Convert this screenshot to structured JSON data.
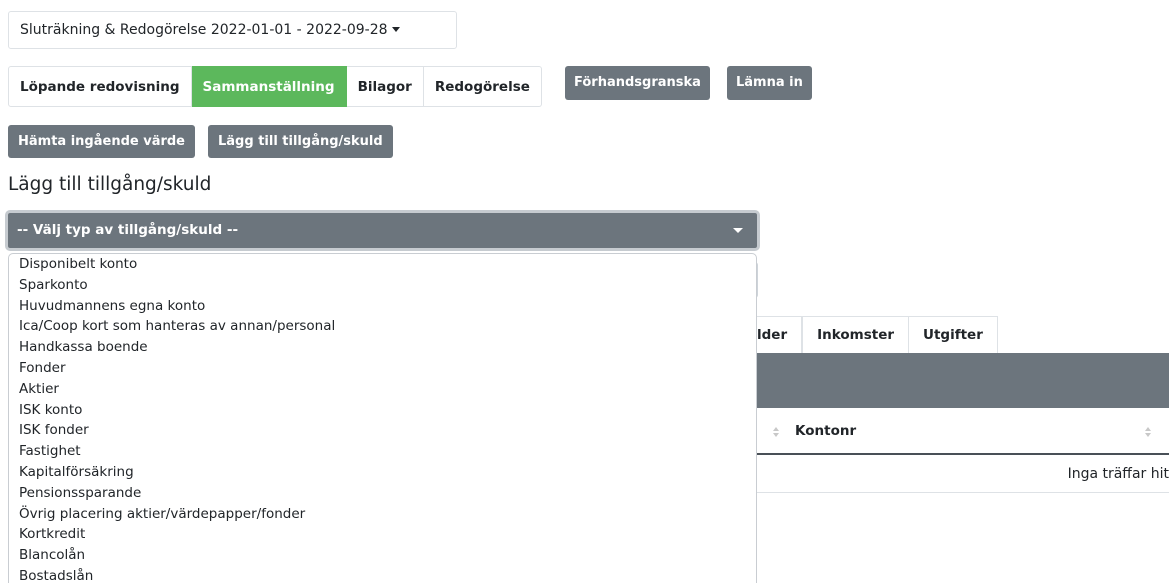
{
  "period_selector": {
    "label": "Sluträkning & Redogörelse 2022-01-01 - 2022-09-28"
  },
  "main_tabs": [
    {
      "label": "Löpande redovisning",
      "active": false
    },
    {
      "label": "Sammanställning",
      "active": true
    },
    {
      "label": "Bilagor",
      "active": false
    },
    {
      "label": "Redogörelse",
      "active": false
    }
  ],
  "actions": {
    "preview_label": "Förhandsgranska",
    "submit_label": "Lämna in"
  },
  "toolbar": {
    "fetch_opening_label": "Hämta ingående värde",
    "add_asset_label": "Lägg till tillgång/skuld"
  },
  "section": {
    "heading": "Lägg till tillgång/skuld"
  },
  "type_select": {
    "selected": "-- Välj typ av tillgång/skuld --",
    "options": [
      "Disponibelt konto",
      "Sparkonto",
      "Huvudmannens egna konto",
      "Ica/Coop kort som hanteras av annan/personal",
      "Handkassa boende",
      "Fonder",
      "Aktier",
      "ISK konto",
      "ISK fonder",
      "Fastighet",
      "Kapitalförsäkring",
      "Pensionssparande",
      "Övrig placering aktier/värdepapper/fonder",
      "Kortkredit",
      "Blancolån",
      "Bostadslån"
    ]
  },
  "sub_tabs": [
    {
      "label": "lder"
    },
    {
      "label": "Inkomster"
    },
    {
      "label": "Utgifter"
    }
  ],
  "table": {
    "column_kontonr": "Kontonr",
    "empty_message": "Inga träffar hit"
  },
  "colors": {
    "active_tab": "#5cb85c",
    "button_gray": "#6c757d"
  }
}
